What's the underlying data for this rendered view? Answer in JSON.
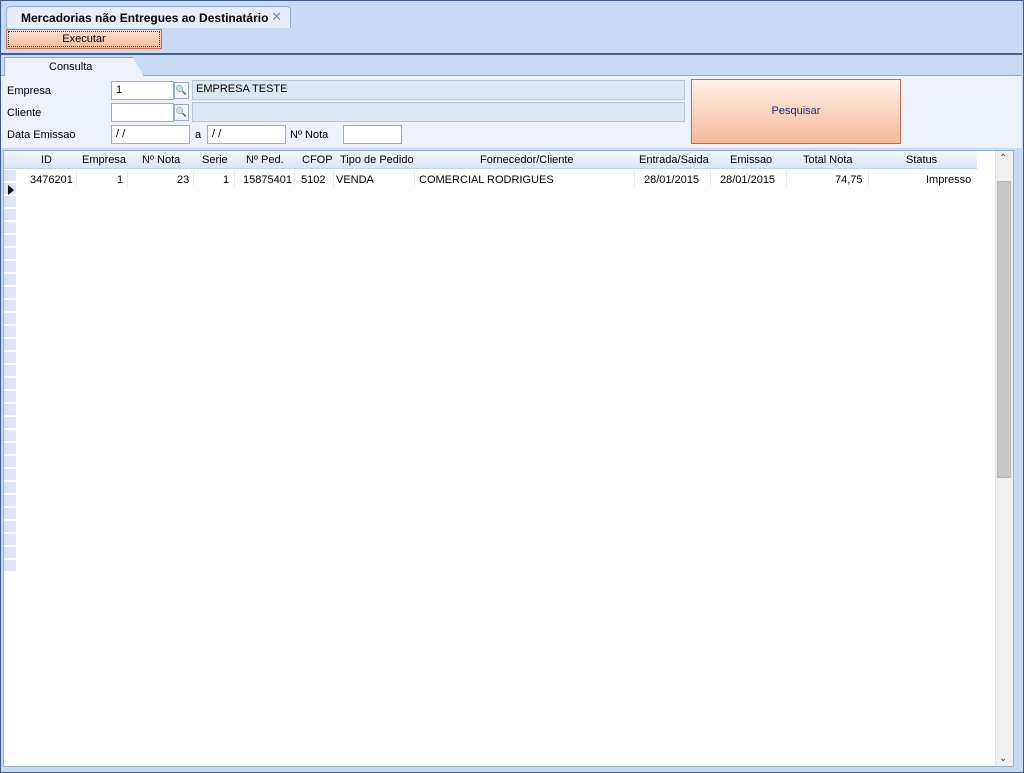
{
  "window": {
    "tab_title": "Mercadorias não Entregues ao Destinatário",
    "close_glyph": "✕"
  },
  "toolbar": {
    "execute_label": "Executar"
  },
  "subtab": {
    "label": "Consulta"
  },
  "form": {
    "empresa_label": "Empresa",
    "empresa_value": "1",
    "empresa_name": "EMPRESA TESTE",
    "cliente_label": "Cliente",
    "cliente_value": "",
    "cliente_name": "",
    "data_label": "Data Emissao",
    "date_from": " / /",
    "date_sep": "a",
    "date_to": " / /",
    "nota_label": "Nº Nota",
    "nota_value": "",
    "search_label": "Pesquisar"
  },
  "grid": {
    "columns": [
      "ID",
      "Empresa",
      "Nº Nota",
      "Serie",
      "Nº Ped.",
      "CFOP",
      "Tipo de Pedido",
      "Fornecedor/Cliente",
      "Entrada/Saida",
      "Emissao",
      "Total Nota",
      "Status"
    ],
    "rows": [
      [
        "3476201",
        "1",
        "23",
        "1",
        "15875401",
        "5102",
        "VENDA",
        "COMERCIAL RODRIGUES",
        "28/01/2015",
        "28/01/2015",
        "74,75",
        "Impresso"
      ]
    ]
  },
  "icons": {
    "lookup": "magnifier-icon",
    "row_pointer": "row-pointer-icon",
    "scroll_up": "chevron-up-icon",
    "scroll_down": "chevron-down-icon"
  }
}
